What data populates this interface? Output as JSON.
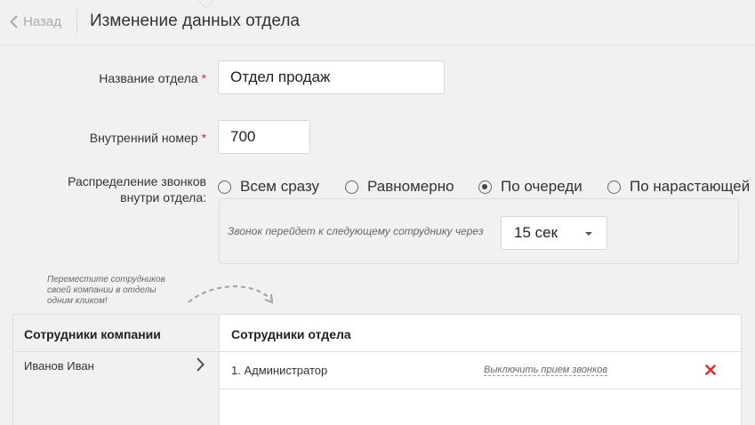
{
  "header": {
    "back_label": "Назад",
    "title": "Изменение данных отдела"
  },
  "form": {
    "name_label": "Название отдела",
    "name_value": "Отдел продаж",
    "ext_label": "Внутренний номер",
    "ext_value": "700",
    "required_mark": "*",
    "dist_label_line1": "Распределение звонков",
    "dist_label_line2": "внутри отдела:",
    "radios": [
      {
        "label": "Всем сразу",
        "selected": false
      },
      {
        "label": "Равномерно",
        "selected": false
      },
      {
        "label": "По очереди",
        "selected": true
      },
      {
        "label": "По нарастающей",
        "selected": false
      }
    ],
    "next_hint": "Звонок перейдет к следующему сотруднику через",
    "next_delay": "15 сек"
  },
  "note": {
    "line1": "Переместите сотрудников",
    "line2": "своей компании в отделы",
    "line3": "одним кликом!"
  },
  "company_panel": {
    "title": "Сотрудники компании",
    "employees": [
      "Иванов Иван"
    ]
  },
  "dept_panel": {
    "title": "Сотрудники отдела",
    "members": [
      {
        "name": "1.  Администратор",
        "action": "Выключить прием звонков"
      }
    ]
  },
  "colors": {
    "required": "#d9312f",
    "remove": "#d9312f"
  }
}
